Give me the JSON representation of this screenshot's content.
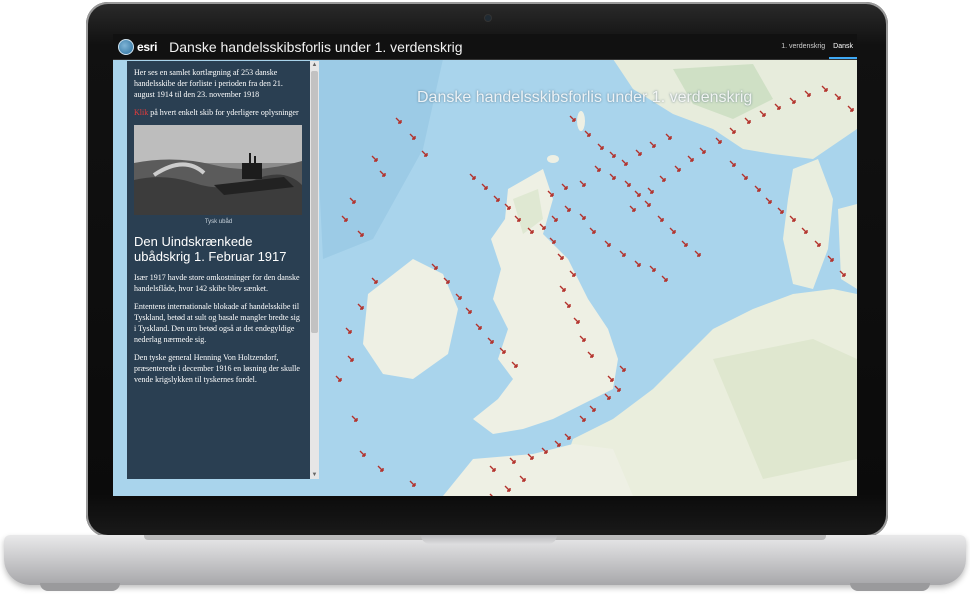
{
  "header": {
    "logo_text": "esri",
    "title": "Danske handelsskibsforlis under 1. verdenskrig",
    "tabs": [
      {
        "label": "1. verdenskrig"
      },
      {
        "label": "Dansk"
      }
    ]
  },
  "map": {
    "title": "Danske handelsskibsforlis under 1. verdenskrig"
  },
  "panel": {
    "intro": "Her ses en samlet kortlægning af 253 danske handelsskibe der forliste i perioden fra den 21. august 1914 til den 23. november 1918",
    "klik_word": "Klik",
    "klik_rest": " på hvert enkelt skib for yderligere oplysninger",
    "photo_caption": "Tysk ubåd",
    "heading": "Den Uindskrænkede ubådskrig 1. Februar 1917",
    "paragraphs": [
      "Især 1917 havde store omkostninger for den danske handelsflåde, hvor 142 skibe blev sænket.",
      "Ententens internationale blokade af handelsskibe til Tyskland, betød at sult og basale mangler bredte sig i Tyskland. Den uro betød også at det endegyldige nederlag nærmede sig.",
      "Den tyske general Henning Von Holtzendorf, præsenterede i december 1916 en løsning der skulle vende krigslykken til tyskernes fordel."
    ]
  },
  "colors": {
    "sea": "#a9d4ec",
    "land": "#eef0e4",
    "marker": "#b3312b",
    "panel": "#2a3f52",
    "header": "#111111",
    "accent": "#3fa9f5"
  },
  "icons": {
    "logo": "esri-globe-icon",
    "marker": "shipwreck-arrow-icon"
  }
}
